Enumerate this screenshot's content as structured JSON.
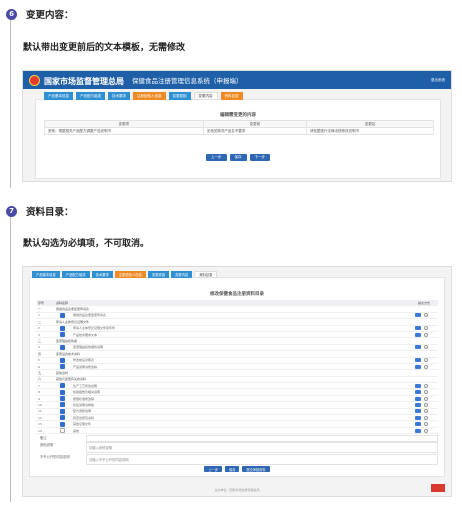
{
  "step6": {
    "number": "6",
    "title": "变更内容：",
    "desc": "默认带出变更前后的文本模板，无需修改",
    "screenshot": {
      "banner_title": "国家市场监督管理总局",
      "banner_sub": "State Administration for Market Regulation",
      "banner_system": "保健食品注册管理信息系统（申报端）",
      "banner_user": "退出系统",
      "tabs": [
        {
          "label": "产品基本信息",
          "color": "#2f8fd3"
        },
        {
          "label": "产品配方组成",
          "color": "#2f8fd3"
        },
        {
          "label": "技术要求",
          "color": "#2f8fd3"
        },
        {
          "label": "注册检验人信息",
          "color": "#f08a24"
        },
        {
          "label": "变更原因",
          "color": "#2f8fd3"
        },
        {
          "label": "变更内容",
          "color": "#ffffff"
        },
        {
          "label": "资料目录",
          "color": "#f08a24"
        }
      ],
      "card_title": "编辑需变更的内容",
      "table": {
        "headers": [
          "变更项",
          "变更前",
          "变更后"
        ],
        "rows": [
          [
            "其他：根据相关产品配方调整产品说明书",
            "无相关情况产品名不要求",
            "请依据现行法律法规修改说明书"
          ]
        ]
      },
      "buttons": [
        "上一步",
        "保存",
        "下一步"
      ]
    }
  },
  "step7": {
    "number": "7",
    "title": "资料目录：",
    "desc": "默认勾选为必填项，不可取消。",
    "screenshot": {
      "tabs": [
        {
          "label": "产品基本信息",
          "color": "#2f8fd3"
        },
        {
          "label": "产品配方组成",
          "color": "#2f8fd3"
        },
        {
          "label": "技术要求",
          "color": "#2f8fd3"
        },
        {
          "label": "注册检验人信息",
          "color": "#f08a24"
        },
        {
          "label": "变更原因",
          "color": "#2f8fd3"
        },
        {
          "label": "变更内容",
          "color": "#2f8fd3"
        },
        {
          "label": "资料目录",
          "color": "#ffffff"
        }
      ],
      "card_title": "修改保健食品注册资料目录",
      "list_header": [
        "序号",
        "资料名称",
        "提交方式"
      ],
      "rows": [
        {
          "kind": "sec",
          "num": "一",
          "text": "保健食品注册变更申请表",
          "checked": false
        },
        {
          "kind": "item",
          "num": "1",
          "text": "保健食品注册变更申请表",
          "checked": true
        },
        {
          "kind": "sec",
          "num": "二",
          "text": "申请人主体登记证明文件",
          "checked": false
        },
        {
          "kind": "item",
          "num": "2",
          "text": "申请人主体登记证明文件复印件",
          "checked": true
        },
        {
          "kind": "item",
          "num": "3",
          "text": "产品技术要求文本",
          "checked": true
        },
        {
          "kind": "sec",
          "num": "三",
          "text": "变更理由和依据",
          "checked": false
        },
        {
          "kind": "item",
          "num": "4",
          "text": "变更理由和依据的说明",
          "checked": true
        },
        {
          "kind": "sec",
          "num": "四",
          "text": "变更后的技术资料",
          "checked": false
        },
        {
          "kind": "item",
          "num": "5",
          "text": "修改前后对照表",
          "checked": true
        },
        {
          "kind": "item",
          "num": "6",
          "text": "产品说明书修改稿",
          "checked": true
        },
        {
          "kind": "sec",
          "num": "五",
          "text": "其他资料",
          "checked": false
        },
        {
          "kind": "sec",
          "num": "六",
          "text": "其他与变更有关的资料",
          "checked": false
        },
        {
          "kind": "item",
          "num": "7",
          "text": "生产工艺修改说明",
          "checked": true
        },
        {
          "kind": "item",
          "num": "8",
          "text": "检验报告及相关说明",
          "checked": true
        },
        {
          "kind": "item",
          "num": "9",
          "text": "质量标准修改稿",
          "checked": true
        },
        {
          "kind": "item",
          "num": "10",
          "text": "标签说明书样稿",
          "checked": true
        },
        {
          "kind": "item",
          "num": "11",
          "text": "配方调整说明",
          "checked": true
        },
        {
          "kind": "item",
          "num": "12",
          "text": "稳定性研究资料",
          "checked": true
        },
        {
          "kind": "item",
          "num": "13",
          "text": "其他证明文件",
          "checked": true
        },
        {
          "kind": "item",
          "num": "14",
          "text": "其他",
          "checked": false
        }
      ],
      "foot_rows": [
        {
          "label": "备注",
          "value": ""
        },
        {
          "label": "其他说明",
          "value": "请输入其他说明"
        },
        {
          "label": "不予公开的内容说明",
          "value": "请输入不予公开的内容说明"
        }
      ],
      "buttons": [
        "上一步",
        "保存",
        "提交审核资料"
      ],
      "footer": "主办单位：国家市场监督管理总局"
    }
  }
}
